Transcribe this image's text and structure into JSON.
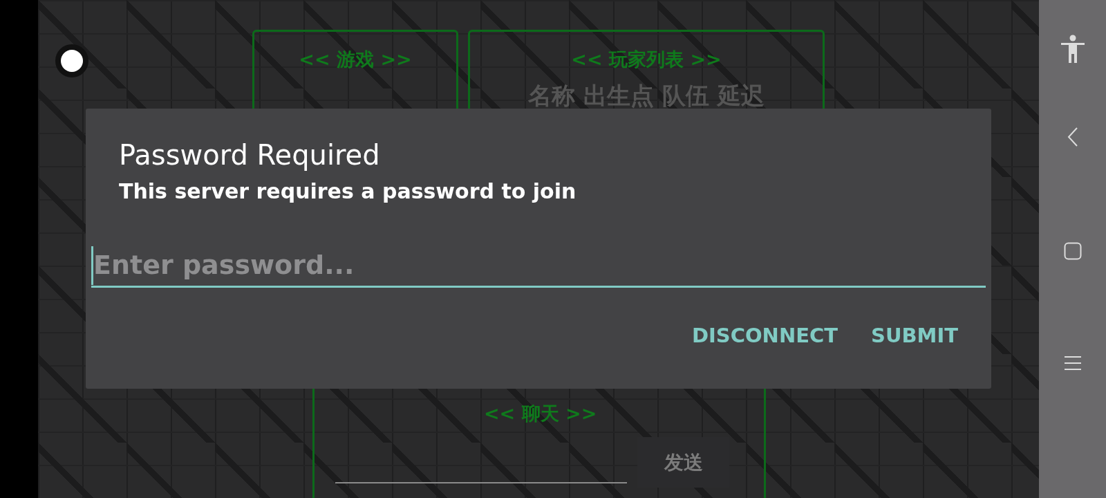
{
  "game_panels": [
    {
      "title": "<< 游戏 >>"
    },
    {
      "title": "<< 玩家列表 >>",
      "header": "名称 出生点 队伍 延迟"
    }
  ],
  "chat": {
    "title": "<< 聊天 >>",
    "send_button": "发送"
  },
  "dialog": {
    "title": "Password Required",
    "message": "This server requires a password to join",
    "password_field": {
      "placeholder": "Enter password..."
    },
    "buttons": [
      "DISCONNECT",
      "SUBMIT"
    ]
  }
}
